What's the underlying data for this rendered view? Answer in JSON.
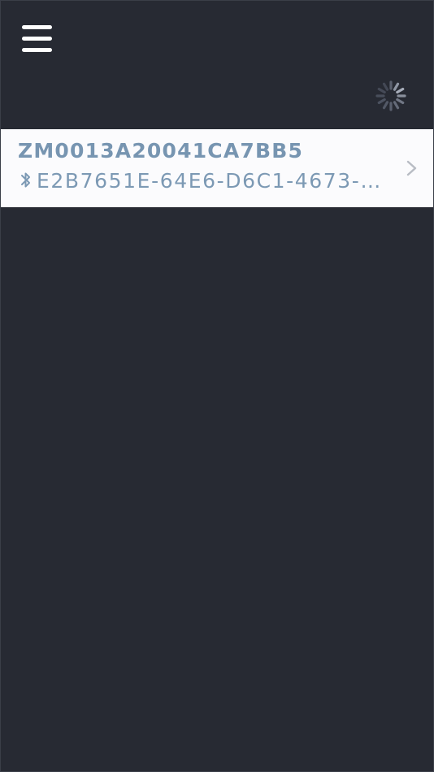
{
  "header": {
    "menu_icon": "hamburger-menu-icon",
    "loading_icon": "spinner-icon"
  },
  "devices": [
    {
      "name": "ZM0013A20041CA7BB5",
      "id": "E2B7651E-64E6-D6C1-4673-…",
      "connection_icon": "bluetooth-icon",
      "nav_icon": "chevron-right-icon"
    }
  ],
  "colors": {
    "background": "#272a33",
    "row_background": "#fbfbfd",
    "row_text": "#7795b1",
    "menu_icon": "#ffffff",
    "spinner": "#c7ccd6"
  }
}
